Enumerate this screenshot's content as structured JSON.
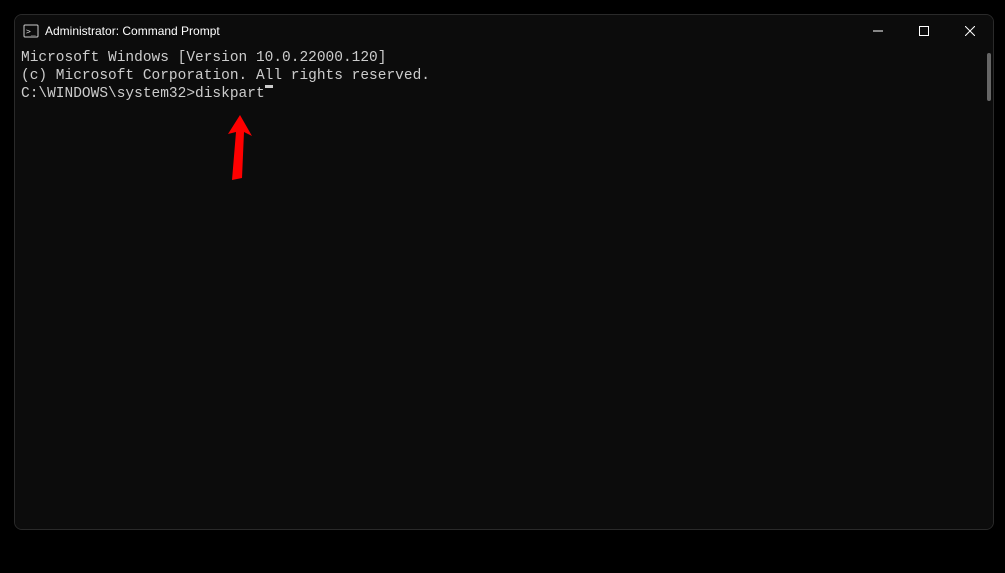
{
  "window": {
    "title": "Administrator: Command Prompt"
  },
  "terminal": {
    "line1": "Microsoft Windows [Version 10.0.22000.120]",
    "line2": "(c) Microsoft Corporation. All rights reserved.",
    "blank": "",
    "prompt": "C:\\WINDOWS\\system32>",
    "command": "diskpart"
  }
}
